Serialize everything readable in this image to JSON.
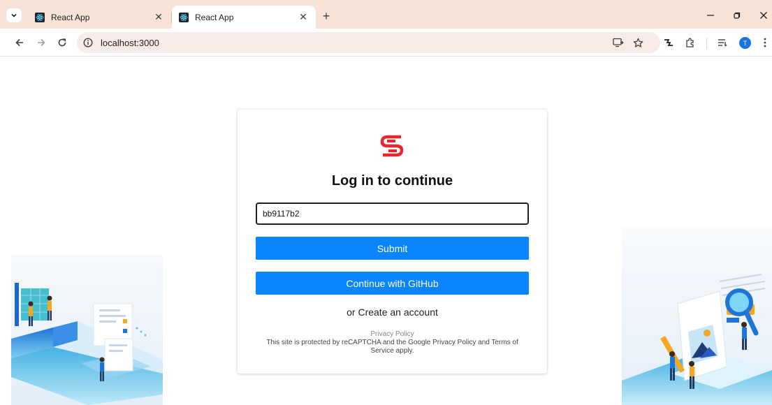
{
  "browser": {
    "tabs": [
      {
        "title": "React App",
        "active": false
      },
      {
        "title": "React App",
        "active": true
      }
    ],
    "url": "localhost:3000",
    "profile_initial": "T",
    "icons": {
      "tab_dropdown": "chevron-down-icon",
      "favicon": "react-logo-icon",
      "close": "close-icon",
      "new_tab": "plus-icon",
      "minimize": "minimize-icon",
      "restore": "restore-icon",
      "close_window": "close-icon",
      "back": "arrow-left-icon",
      "forward": "arrow-right-icon",
      "reload": "reload-icon",
      "site_info": "info-icon",
      "install": "install-app-icon",
      "bookmark": "star-icon",
      "extension_1": "extension-icon",
      "extensions": "puzzle-icon",
      "reading_list": "reading-list-icon",
      "menu": "kebab-menu-icon"
    }
  },
  "login": {
    "logo": "s-logo-icon",
    "heading": "Log in to continue",
    "input_value": "bb9117b2",
    "submit_label": "Submit",
    "github_label": "Continue with GitHub",
    "create_account": "or Create an account",
    "privacy_policy": "Privacy Policy",
    "recaptcha_notice": "This site is protected by reCAPTCHA and the Google Privacy Policy and Terms of Service apply."
  },
  "colors": {
    "tabbar": "#f9e3d9",
    "omnibox": "#f7ece7",
    "primary_button": "#0a84ff",
    "logo_red": "#e8262c",
    "avatar": "#1a73e8"
  }
}
